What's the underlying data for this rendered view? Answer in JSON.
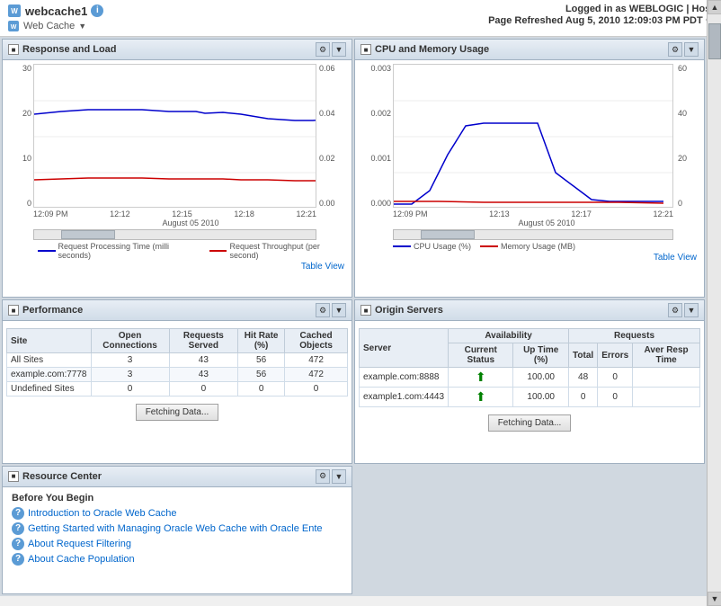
{
  "header": {
    "app_name": "webcache1",
    "app_subtitle": "Web Cache",
    "logged_in_label": "Logged in as",
    "user": "WEBLOGIC",
    "separator": "|",
    "host": "Host",
    "page_refreshed": "Page Refreshed Aug 5, 2010  12:09:03 PM PDT",
    "info_icon": "i",
    "dropdown_arrow": "▼",
    "refresh_icon": "↺"
  },
  "panels": {
    "response_load": {
      "title": "Response and Load",
      "y_axis_left": [
        "30",
        "20",
        "10",
        "0"
      ],
      "y_axis_right": [
        "0.06",
        "0.04",
        "0.02",
        "0.00"
      ],
      "x_axis": [
        "12:09 PM",
        "12:12",
        "12:15",
        "12:18",
        "12:21"
      ],
      "date_label": "August 05 2010",
      "legend": [
        {
          "label": "Request Processing Time (milli seconds)",
          "color": "#0000cc"
        },
        {
          "label": "Request Throughput (per second)",
          "color": "#cc0000"
        }
      ],
      "table_view": "Table View"
    },
    "cpu_memory": {
      "title": "CPU and Memory Usage",
      "y_axis_left": [
        "0.003",
        "0.002",
        "0.001",
        "0.000"
      ],
      "y_axis_right": [
        "60",
        "40",
        "20",
        "0"
      ],
      "x_axis": [
        "12:09 PM",
        "12:13",
        "12:17",
        "12:21"
      ],
      "date_label": "August 05 2010",
      "legend": [
        {
          "label": "CPU Usage (%)",
          "color": "#0000cc"
        },
        {
          "label": "Memory Usage (MB)",
          "color": "#cc0000"
        }
      ],
      "table_view": "Table View"
    },
    "performance": {
      "title": "Performance",
      "columns": [
        "Site",
        "Open Connections",
        "Requests Served",
        "Hit Rate (%)",
        "Cached Objects"
      ],
      "rows": [
        {
          "site": "All Sites",
          "open": "3",
          "requests": "43",
          "hit_rate": "56",
          "cached": "472"
        },
        {
          "site": "example.com:7778",
          "open": "3",
          "requests": "43",
          "hit_rate": "56",
          "cached": "472"
        },
        {
          "site": "Undefined Sites",
          "open": "0",
          "requests": "0",
          "hit_rate": "0",
          "cached": "0"
        }
      ],
      "fetch_btn": "Fetching Data..."
    },
    "origin_servers": {
      "title": "Origin Servers",
      "group_headers": {
        "availability": "Availability",
        "requests": "Requests"
      },
      "columns": [
        "Server",
        "Current Status",
        "Up Time (%)",
        "Total",
        "Errors",
        "Aver Resp Time"
      ],
      "rows": [
        {
          "server": "example.com:8888",
          "status": "up",
          "uptime": "100.00",
          "total": "48",
          "errors": "0"
        },
        {
          "server": "example1.com:4443",
          "status": "up",
          "uptime": "100.00",
          "total": "0",
          "errors": "0"
        }
      ],
      "fetch_btn": "Fetching Data..."
    },
    "resource_center": {
      "title": "Resource Center",
      "section_title": "Before You Begin",
      "links": [
        "Introduction to Oracle Web Cache",
        "Getting Started with Managing Oracle Web Cache with Oracle Ente",
        "About Request Filtering",
        "About Cache Population"
      ]
    }
  }
}
